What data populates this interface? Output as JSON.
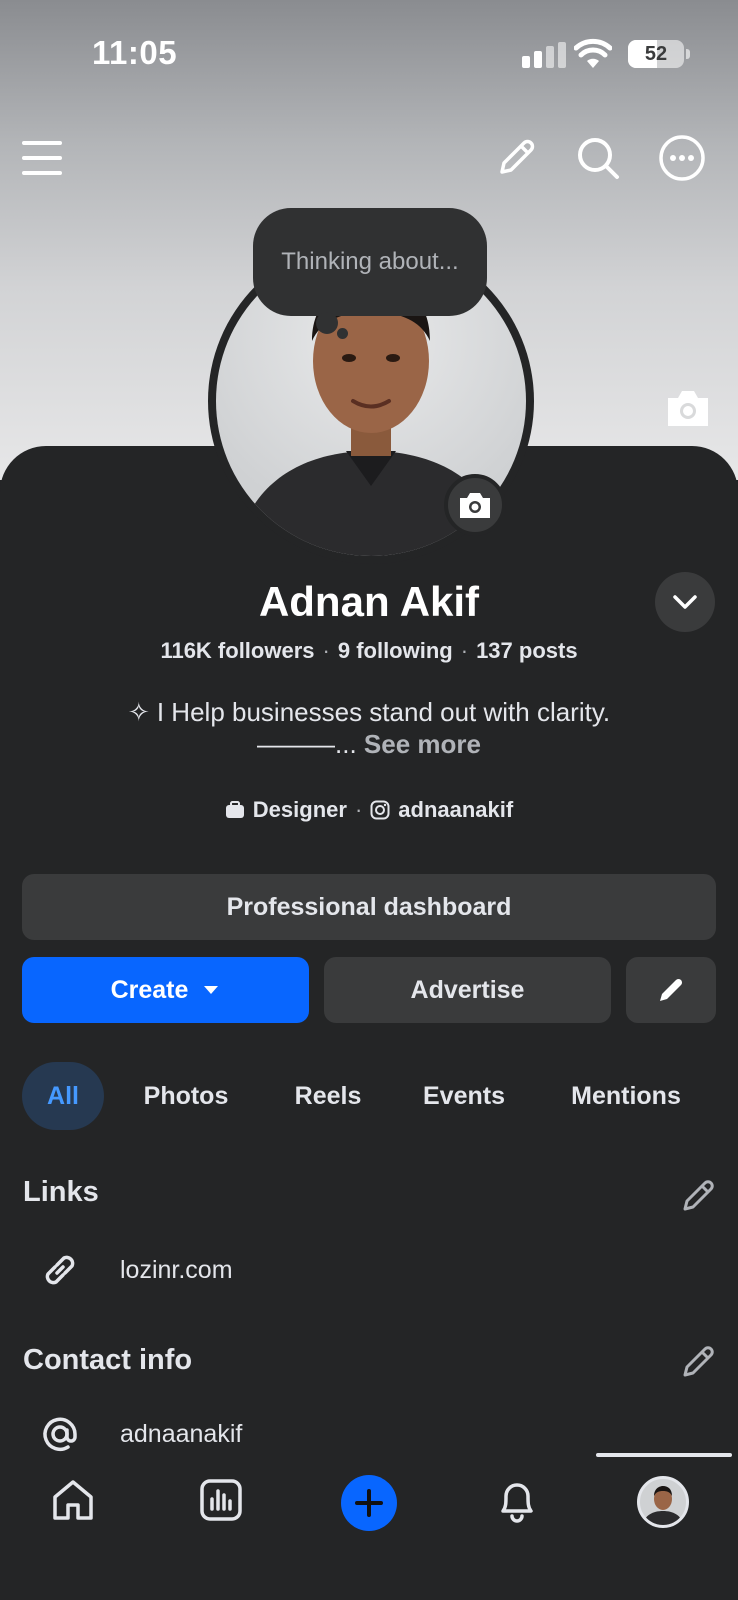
{
  "status_bar": {
    "time": "11:05",
    "battery": "52",
    "battery_level": 0.52
  },
  "cover": {
    "camera_icon": "camera-icon"
  },
  "header_icons": [
    "menu-icon",
    "edit-icon",
    "search-icon",
    "more-icon"
  ],
  "profile": {
    "thought_bubble": "Thinking about...",
    "name": "Adnan Akif",
    "followers": "116K followers",
    "following": "9 following",
    "posts": "137 posts",
    "bio_line1": "✧ I Help businesses stand out with clarity.",
    "bio_line2_prefix": "———...",
    "see_more": "See more",
    "category": "Designer",
    "instagram": "adnaanakif"
  },
  "actions": {
    "dashboard": "Professional dashboard",
    "create": "Create",
    "advertise": "Advertise"
  },
  "tabs": [
    {
      "label": "All",
      "active": true
    },
    {
      "label": "Photos",
      "active": false
    },
    {
      "label": "Reels",
      "active": false
    },
    {
      "label": "Events",
      "active": false
    },
    {
      "label": "Mentions",
      "active": false
    }
  ],
  "links": {
    "title": "Links",
    "items": [
      {
        "text": "lozinr.com",
        "icon": "link-icon"
      }
    ]
  },
  "contact": {
    "title": "Contact info",
    "items": [
      {
        "text": "adnaanakif",
        "icon": "at-icon"
      }
    ]
  },
  "bottom_nav": [
    "home-icon",
    "dashboard-icon",
    "plus-icon",
    "bell-icon",
    "profile-avatar"
  ],
  "colors": {
    "accent": "#0866ff",
    "active_tab_bg": "#263951",
    "active_tab_text": "#4599ff",
    "background": "#242526",
    "surface": "#3a3b3c"
  }
}
